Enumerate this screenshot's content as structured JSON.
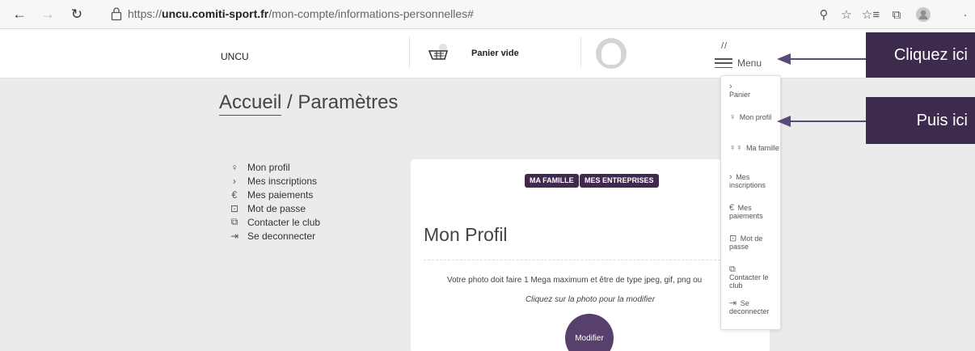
{
  "browser": {
    "url_protocol": "https://",
    "url_domain": "uncu.comiti-sport.fr",
    "url_path": "/mon-compte/informations-personnelles#",
    "back_glyph": "←",
    "forward_glyph": "→",
    "refresh_glyph": "↻",
    "zoom_glyph": "⚲",
    "favorite_glyph": "☆",
    "favorites_list_glyph": "☆≡",
    "collections_glyph": "⧉",
    "more_glyph": "·"
  },
  "header": {
    "brand": "UNCU",
    "cart_label": "Panier vide",
    "slashes": "//",
    "menu_label": "Menu"
  },
  "breadcrumb": {
    "home": "Accueil",
    "separator": " / ",
    "current": "Paramètres"
  },
  "side_menu": [
    {
      "label": "Mon profil",
      "icon_glyph": "♀"
    },
    {
      "label": "Mes inscriptions",
      "icon_glyph": "›"
    },
    {
      "label": "Mes paiements",
      "icon_glyph": "€"
    },
    {
      "label": "Mot de passe",
      "icon_glyph": "⊡"
    },
    {
      "label": "Contacter le club",
      "icon_glyph": "⧉"
    },
    {
      "label": "Se deconnecter",
      "icon_glyph": "⇥"
    }
  ],
  "card": {
    "tab_family": "MA FAMILLE",
    "tab_companies": "MES ENTREPRISES",
    "title": "Mon Profil",
    "description": "Votre photo doit faire 1 Mega maximum et être de type jpeg, gif, png ou",
    "hint": "Cliquez sur la photo pour la modifier",
    "photo_button": "Modifier"
  },
  "dropdown": [
    {
      "icon_glyph": "›",
      "label": "Panier"
    },
    {
      "icon_glyph": "♀",
      "label": "Mon profil"
    },
    {
      "icon_glyph": "♀♀",
      "label": "Ma famille"
    },
    {
      "icon_glyph": "›",
      "label": "Mes inscriptions"
    },
    {
      "icon_glyph": "€",
      "label": "Mes paiements"
    },
    {
      "icon_glyph": "⊡",
      "label": "Mot de passe"
    },
    {
      "icon_glyph": "⧉",
      "label": "Contacter le club"
    },
    {
      "icon_glyph": "⇥",
      "label": "Se deconnecter"
    }
  ],
  "annotations": {
    "callout_1": "Cliquez ici",
    "callout_2": "Puis ici"
  },
  "colors": {
    "accent": "#40284f",
    "callout": "#3d2b4e"
  }
}
